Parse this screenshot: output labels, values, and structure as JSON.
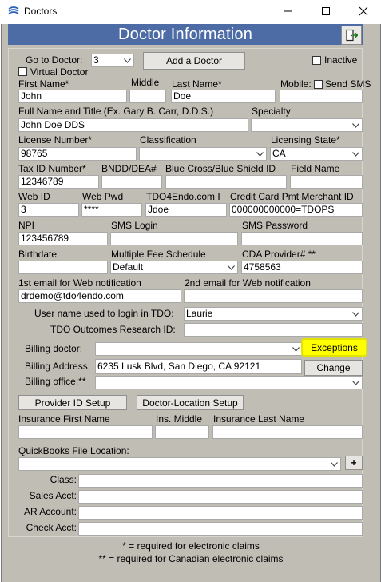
{
  "window": {
    "title": "Doctors"
  },
  "header": {
    "title": "Doctor Information"
  },
  "goto": {
    "label": "Go to Doctor:",
    "value": "3",
    "add_label": "Add a Doctor",
    "inactive_label": "Inactive",
    "virtual_label": "Virtual Doctor"
  },
  "name": {
    "first_label": "First Name*",
    "first_value": "John",
    "middle_label": "Middle",
    "middle_value": "",
    "last_label": "Last Name*",
    "last_value": "Doe",
    "mobile_label": "Mobile:",
    "send_sms_label": "Send SMS",
    "mobile_value": ""
  },
  "full_name": {
    "label": "Full Name and Title (Ex. Gary B. Carr, D.D.S.)",
    "value": "John Doe DDS",
    "specialty_label": "Specialty",
    "specialty_value": ""
  },
  "license": {
    "number_label": "License Number*",
    "number_value": "98765",
    "class_label": "Classification",
    "class_value": "",
    "state_label": "Licensing State*",
    "state_value": "CA"
  },
  "ids": {
    "tax_label": "Tax ID Number*",
    "tax_value": "12346789",
    "bndd_label": "BNDD/DEA#",
    "bndd_value": "",
    "bc_label": "Blue Cross/Blue Shield ID",
    "bc_value": "",
    "field_label": "Field Name",
    "field_value": ""
  },
  "web": {
    "id_label": "Web ID",
    "id_value": "3",
    "pwd_label": "Web Pwd",
    "pwd_value": "****",
    "tdo_label": "TDO4Endo.com I",
    "tdo_value": "Jdoe",
    "cc_label": "Credit Card Pmt Merchant ID",
    "cc_value": "000000000000=TDOPS"
  },
  "npi": {
    "npi_label": "NPI",
    "npi_value": "123456789",
    "sms_login_label": "SMS Login",
    "sms_login_value": "",
    "sms_pwd_label": "SMS Password",
    "sms_pwd_value": ""
  },
  "misc": {
    "birth_label": "Birthdate",
    "birth_value": "",
    "fee_label": "Multiple Fee Schedule",
    "fee_value": "Default",
    "cda_label": "CDA Provider# **",
    "cda_value": "4758563"
  },
  "email": {
    "first_label": "1st email for Web notification",
    "first_value": "drdemo@tdo4endo.com",
    "second_label": "2nd email for Web notification",
    "second_value": ""
  },
  "tdo": {
    "user_label": "User name used to login in TDO:",
    "user_value": "Laurie",
    "outcomes_label": "TDO Outcomes Research ID:",
    "outcomes_value": ""
  },
  "billing": {
    "doctor_label": "Billing doctor:",
    "doctor_value": "",
    "exceptions_label": "Exceptions",
    "address_label": "Billing Address:",
    "address_value": "6235 Lusk Blvd, San Diego, CA 92121",
    "change_label": "Change",
    "office_label": "Billing office:**",
    "office_value": ""
  },
  "setup": {
    "provider_label": "Provider ID Setup",
    "location_label": "Doctor-Location Setup"
  },
  "insurance": {
    "first_label": "Insurance First Name",
    "middle_label": "Ins. Middle",
    "last_label": "Insurance Last Name",
    "first_value": "",
    "middle_value": "",
    "last_value": ""
  },
  "quickbooks": {
    "file_label": "QuickBooks File Location:",
    "file_value": "",
    "add_label": "+",
    "class_label": "Class:",
    "class_value": "",
    "sales_label": "Sales Acct:",
    "sales_value": "",
    "ar_label": "AR Account:",
    "ar_value": "",
    "check_label": "Check Acct:",
    "check_value": ""
  },
  "footer": {
    "note1": "* = required for electronic claims",
    "note2": "** = required for Canadian electronic claims"
  },
  "colors": {
    "header_bg": "#4d6ca6",
    "highlight": "#ffff00",
    "client_bg": "#c0bdb5"
  },
  "icons": [
    "app-icon",
    "minimize-icon",
    "maximize-icon",
    "close-icon",
    "exit-door-icon",
    "chevron-down-icon"
  ]
}
